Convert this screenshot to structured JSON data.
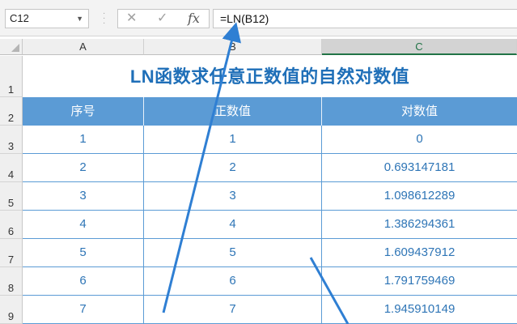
{
  "formula_bar": {
    "name_box": "C12",
    "cancel_glyph": "✕",
    "enter_glyph": "✓",
    "fx_label": "fx",
    "formula": "=LN(B12)"
  },
  "columns": [
    "A",
    "B",
    "C"
  ],
  "rows": [
    "1",
    "2",
    "3",
    "4",
    "5",
    "6",
    "7",
    "8",
    "9"
  ],
  "sheet": {
    "title": "LN函数求任意正数值的自然对数值",
    "headers": [
      "序号",
      "正数值",
      "对数值"
    ],
    "data": [
      [
        "1",
        "1",
        "0"
      ],
      [
        "2",
        "2",
        "0.693147181"
      ],
      [
        "3",
        "3",
        "1.098612289"
      ],
      [
        "4",
        "4",
        "1.386294361"
      ],
      [
        "5",
        "5",
        "1.609437912"
      ],
      [
        "6",
        "6",
        "1.791759469"
      ],
      [
        "7",
        "7",
        "1.945910149"
      ]
    ]
  },
  "colors": {
    "header_fill": "#5b9bd5",
    "text_blue": "#2e75b6",
    "title_blue": "#1f6fb8",
    "arrow_blue": "#2f7fd3"
  }
}
